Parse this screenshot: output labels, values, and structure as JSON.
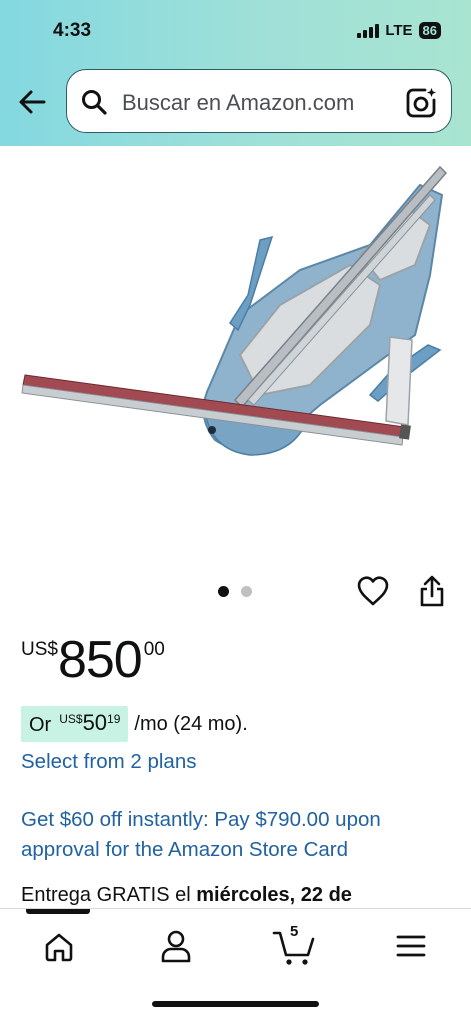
{
  "status": {
    "time": "4:33",
    "network": "LTE",
    "battery": "86"
  },
  "search": {
    "placeholder": "Buscar en Amazon.com"
  },
  "product": {
    "image_alt": "Tile cutter",
    "image_count": 2,
    "active_image": 1
  },
  "price": {
    "currency": "US$",
    "whole": "850",
    "fraction": "00"
  },
  "finance": {
    "or": "Or",
    "currency": "US$",
    "whole": "50",
    "fraction": "19",
    "term": "/mo (24 mo)."
  },
  "plans_link": "Select from 2 plans",
  "promo": "Get $60 off instantly: Pay $790.00 upon approval for the Amazon Store Card",
  "delivery": {
    "prefix": "Entrega GRATIS el ",
    "date": "miércoles, 22 de"
  },
  "bottom_nav": {
    "cart_count": "5"
  },
  "colors": {
    "link": "#2162a1",
    "finance_bg": "#c8f3e4",
    "header_start": "#84d8e0",
    "header_end": "#a8e4d0"
  },
  "icons": [
    "back-arrow-icon",
    "search-icon",
    "camera-icon",
    "heart-icon",
    "share-icon",
    "home-icon",
    "account-icon",
    "cart-icon",
    "menu-icon"
  ]
}
